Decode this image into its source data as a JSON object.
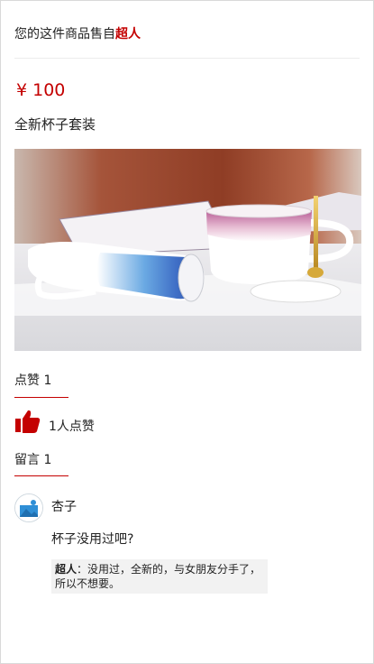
{
  "header": {
    "prefix": "您的这件商品售自",
    "seller_name": "超人"
  },
  "product": {
    "price": "¥ 100",
    "title": "全新杯子套装"
  },
  "likes": {
    "heading": "点赞 1",
    "summary": "1人点赞"
  },
  "comments": {
    "heading": "留言 1",
    "items": [
      {
        "author": "杏子",
        "text": "杯子没用过吧?",
        "reply_author": "超人",
        "reply_separator": "：",
        "reply_text": "没用过，全新的，与女朋友分手了，所以不想要。"
      }
    ]
  },
  "colors": {
    "accent": "#c40000",
    "reply_bg": "#f2f2f2",
    "divider": "#ececec"
  },
  "icons": {
    "like": "thumbs-up-icon",
    "avatar": "default-avatar-icon"
  }
}
